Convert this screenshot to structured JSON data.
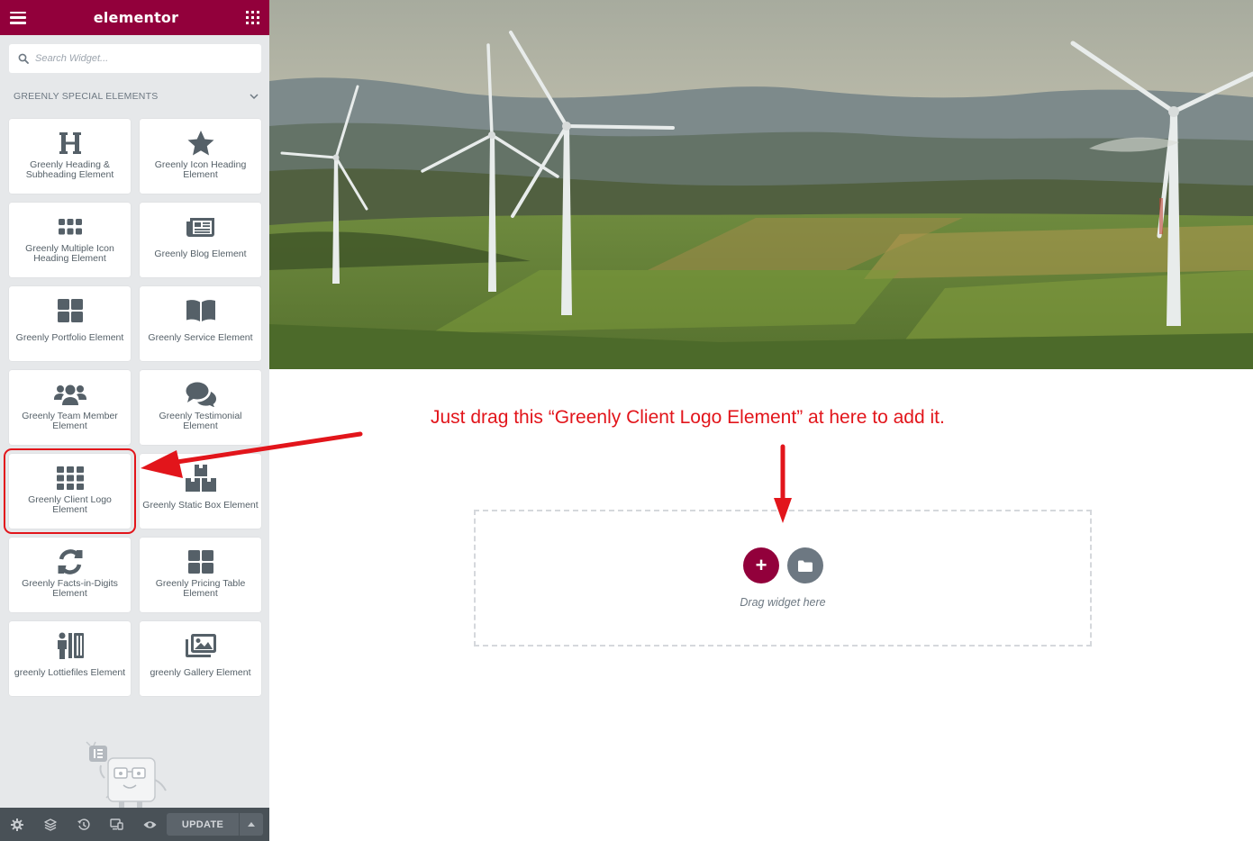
{
  "app": {
    "name": "elementor"
  },
  "search": {
    "placeholder": "Search Widget..."
  },
  "category": {
    "label": "GREENLY SPECIAL ELEMENTS"
  },
  "widgets": [
    {
      "label": "Greenly Heading & Subheading Element",
      "icon": "heading-icon"
    },
    {
      "label": "Greenly Icon Heading Element",
      "icon": "star-icon"
    },
    {
      "label": "Greenly Multiple Icon Heading Element",
      "icon": "grid-dots-icon"
    },
    {
      "label": "Greenly Blog Element",
      "icon": "newspaper-icon"
    },
    {
      "label": "Greenly Portfolio Element",
      "icon": "grid-four-icon"
    },
    {
      "label": "Greenly Service Element",
      "icon": "book-open-icon"
    },
    {
      "label": "Greenly Team Member Element",
      "icon": "users-icon"
    },
    {
      "label": "Greenly Testimonial Element",
      "icon": "comments-icon"
    },
    {
      "label": "Greenly Client Logo Element",
      "icon": "grid-nine-icon"
    },
    {
      "label": "Greenly Static Box Element",
      "icon": "boxes-icon"
    },
    {
      "label": "Greenly Facts-in-Digits Element",
      "icon": "sync-icon"
    },
    {
      "label": "Greenly Pricing Table Element",
      "icon": "grid-four-icon"
    },
    {
      "label": "greenly Lottiefiles Element",
      "icon": "people-arrows-icon"
    },
    {
      "label": "greenly Gallery Element",
      "icon": "images-icon"
    }
  ],
  "bottom_bar": {
    "icons": [
      "settings-icon",
      "layers-icon",
      "history-icon",
      "responsive-icon",
      "preview-icon"
    ],
    "update_label": "UPDATE"
  },
  "canvas": {
    "instruction": "Just drag this “Greenly Client Logo Element” at here to add it.",
    "drop_text": "Drag widget here",
    "add_symbol": "+"
  },
  "colors": {
    "brand": "#92003b",
    "annotation": "#e2151b",
    "sidebar_bg": "#e6e8ea",
    "icon": "#556068"
  }
}
